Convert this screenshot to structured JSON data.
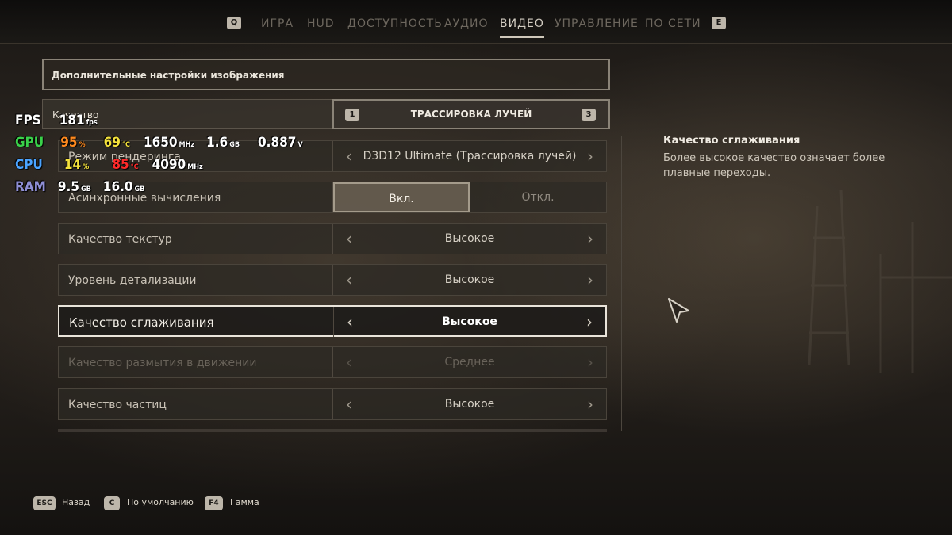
{
  "nav": {
    "left_key": "Q",
    "right_key": "E",
    "tabs": [
      {
        "label": "ИГРА"
      },
      {
        "label": "HUD"
      },
      {
        "label": "ДОСТУПНОСТЬ"
      },
      {
        "label": "АУДИО"
      },
      {
        "label": "ВИДЕО"
      },
      {
        "label": "УПРАВЛЕНИЕ"
      },
      {
        "label": "ПО СЕТИ"
      }
    ],
    "active_tab": "ВИДЕО"
  },
  "panel": {
    "header": "Дополнительные настройки изображения",
    "quality": {
      "label": "Качество",
      "value": "ТРАССИРОВКА ЛУЧЕЙ",
      "prev_key": "1",
      "next_key": "3"
    },
    "settings": [
      {
        "label": "Режим рендеринга",
        "value": "D3D12 Ultimate (Трассировка лучей)"
      },
      {
        "label": "Асинхронные вычисления",
        "options": [
          "Вкл.",
          "Откл."
        ],
        "selected": "Вкл."
      },
      {
        "label": "Качество текстур",
        "value": "Высокое"
      },
      {
        "label": "Уровень детализации",
        "value": "Высокое"
      },
      {
        "label": "Качество сглаживания",
        "value": "Высокое",
        "state": "selected"
      },
      {
        "label": "Качество размытия в движении",
        "value": "Среднее",
        "state": "disabled"
      },
      {
        "label": "Качество частиц",
        "value": "Высокое"
      }
    ]
  },
  "description": {
    "title": "Качество сглаживания",
    "text": "Более высокое качество означает более плавные переходы."
  },
  "help": [
    {
      "key": "ESC",
      "label": "Назад"
    },
    {
      "key": "C",
      "label": "По умолчанию"
    },
    {
      "key": "F4",
      "label": "Гамма"
    }
  ],
  "overlay": {
    "fps": {
      "tag": "FPS",
      "value": "181",
      "unit": "fps"
    },
    "gpu": {
      "tag": "GPU",
      "load": "95",
      "load_unit": "%",
      "temp": "69",
      "temp_unit": "°C",
      "clock": "1650",
      "clock_unit": "MHz",
      "mem": "1.6",
      "mem_unit": "GB",
      "volt": "0.887",
      "volt_unit": "V"
    },
    "cpu": {
      "tag": "CPU",
      "load": "14",
      "load_unit": "%",
      "temp": "85",
      "temp_unit": "°C",
      "clock": "4090",
      "clock_unit": "MHz"
    },
    "ram": {
      "tag": "RAM",
      "used": "9.5",
      "used_unit": "GB",
      "total": "16.0",
      "total_unit": "GB"
    },
    "colors": {
      "fps": "#ffffff",
      "gpu": "#3ad14a",
      "cpu": "#4aa3ff",
      "ram": "#8f8fd6",
      "load": "#ff8a1f",
      "temp_ok": "#f4e23c",
      "temp_hot": "#ff2a2a",
      "cpu_load": "#f4e23c"
    }
  }
}
